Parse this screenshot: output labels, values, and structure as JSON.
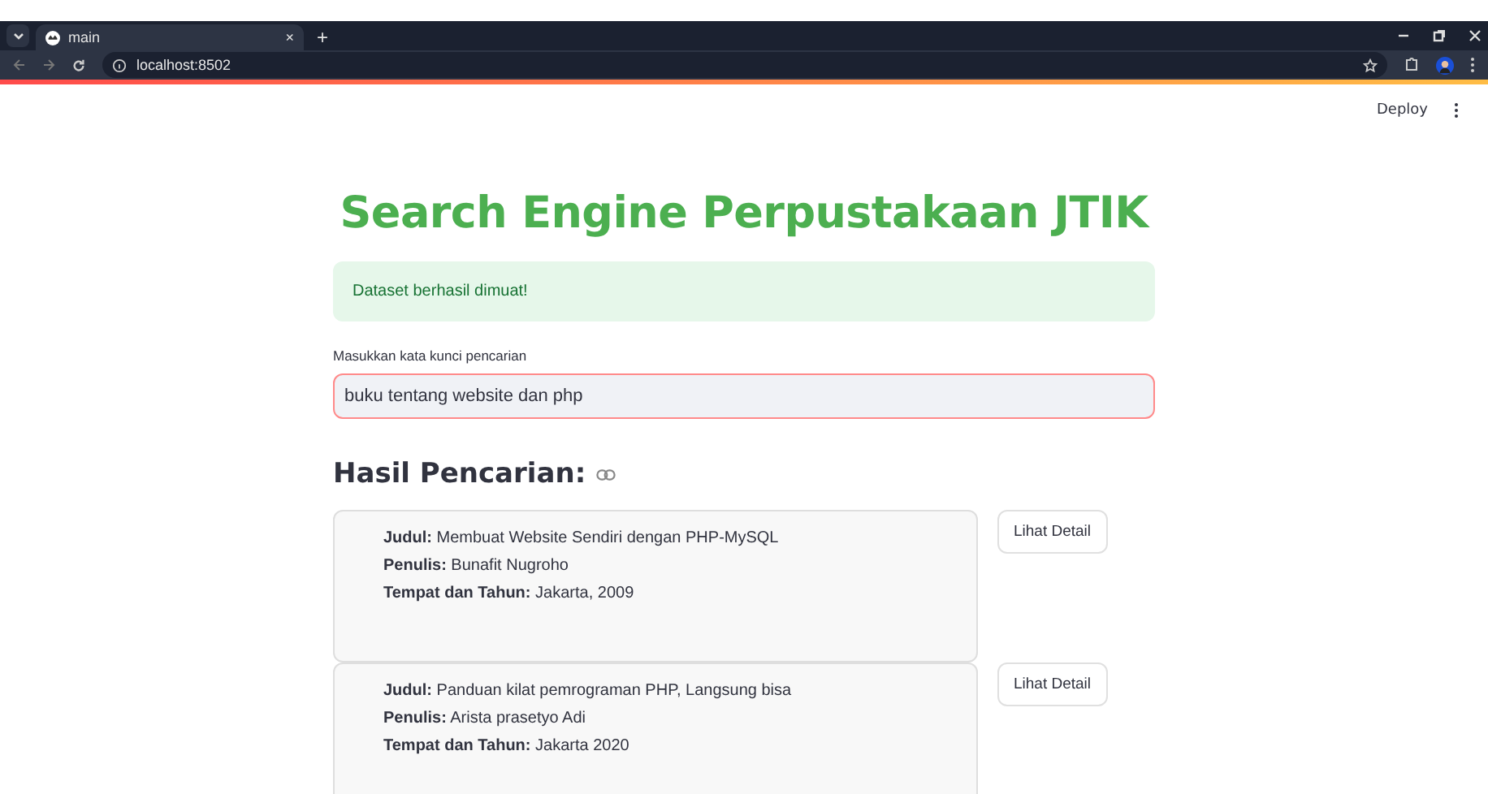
{
  "browser": {
    "tab": {
      "title": "main",
      "close": "×"
    },
    "new_tab": "+",
    "address": "localhost:8502"
  },
  "app_header": {
    "deploy": "Deploy"
  },
  "title": "Search Engine Perpustakaan JTIK",
  "alert": "Dataset berhasil dimuat!",
  "search": {
    "label": "Masukkan kata kunci pencarian",
    "value": "buku tentang website dan php"
  },
  "results_heading": "Hasil Pencarian:",
  "results": [
    {
      "lines": [
        "**Judul:** Membuat Website Sendiri dengan PHP-MySQL",
        "**Penulis:** Bunafit Nugroho",
        "**Tempat dan Tahun:** Jakarta, 2009"
      ],
      "button": "Lihat Detail"
    },
    {
      "lines": [
        "**Judul:** Panduan kilat pemrograman PHP, Langsung bisa",
        "**Penulis:** Arista prasetyo Adi",
        "**Tempat dan Tahun:** Jakarta 2020"
      ],
      "button": "Lihat Detail"
    }
  ]
}
